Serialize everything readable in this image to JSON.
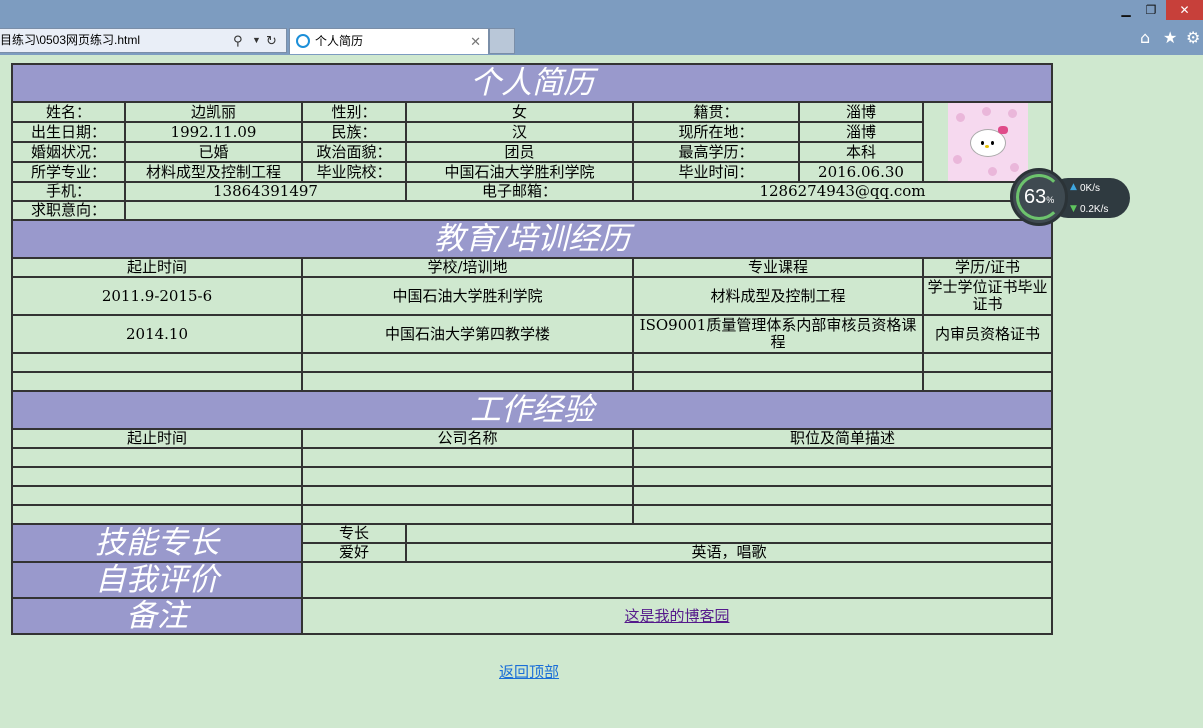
{
  "browser": {
    "address": "目练习\\0503网页练习.html",
    "tab_title": "个人简历"
  },
  "resume": {
    "title": "个人简历",
    "info_rows": [
      {
        "l1": "姓名：",
        "v1": "边凯丽",
        "l2": "性别：",
        "v2": "女",
        "l3": "籍贯：",
        "v3": "淄博"
      },
      {
        "l1": "出生日期：",
        "v1": "1992.11.09",
        "l2": "民族：",
        "v2": "汉",
        "l3": "现所在地：",
        "v3": "淄博"
      },
      {
        "l1": "婚姻状况：",
        "v1": "已婚",
        "l2": "政治面貌：",
        "v2": "团员",
        "l3": "最高学历：",
        "v3": "本科"
      },
      {
        "l1": "所学专业：",
        "v1": "材料成型及控制工程",
        "l2": "毕业院校：",
        "v2": "中国石油大学胜利学院",
        "l3": "毕业时间：",
        "v3": "2016.06.30"
      }
    ],
    "phone_label": "手机：",
    "phone": "13864391497",
    "email_label": "电子邮箱：",
    "email": "1286274943@qq.com",
    "intent_label": "求职意向：",
    "intent": "",
    "education": {
      "title": "教育/培训经历",
      "headers": [
        "起止时间",
        "学校/培训地",
        "专业课程",
        "学历/证书"
      ],
      "rows": [
        [
          "2011.9-2015-6",
          "中国石油大学胜利学院",
          "材料成型及控制工程",
          "学士学位证书毕业证书"
        ],
        [
          "2014.10",
          "中国石油大学第四教学楼",
          "ISO9001质量管理体系内部审核员资格课程",
          "内审员资格证书"
        ]
      ]
    },
    "work": {
      "title": "工作经验",
      "headers": [
        "起止时间",
        "公司名称",
        "职位及简单描述"
      ]
    },
    "skills": {
      "title": "技能专长",
      "specialty_label": "专长",
      "specialty": "",
      "hobby_label": "爱好",
      "hobby": "英语，唱歌"
    },
    "self_eval": {
      "title": "自我评价",
      "value": ""
    },
    "notes": {
      "title": "备注",
      "link": "这是我的博客园"
    }
  },
  "back_to_top": "返回顶部",
  "speed_widget": {
    "percent": "63",
    "percent_unit": "%",
    "up": "0K/s",
    "down": "0.2K/s"
  },
  "colors": {
    "header_bg": "#9999cc",
    "page_bg": "#cfe8cf"
  }
}
